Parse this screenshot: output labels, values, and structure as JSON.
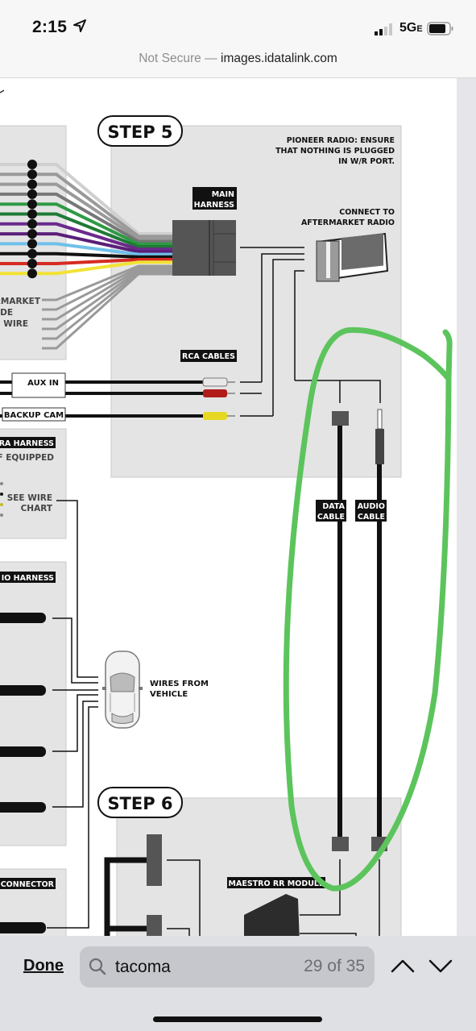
{
  "status_bar": {
    "time": "2:15",
    "location_icon": "location-arrow-icon",
    "signal_icon": "cellular-signal-icon",
    "network": "5G",
    "network_suffix": "E",
    "battery_icon": "battery-icon"
  },
  "url_bar": {
    "security_label": "Not Secure —",
    "host": "images.idatalink.com"
  },
  "diagram": {
    "step5": {
      "badge": "STEP 5",
      "note_lines": [
        "PIONEER RADIO: ENSURE",
        "THAT NOTHING IS PLUGGED",
        "IN W/R PORT."
      ],
      "main_harness_lines": [
        "MAIN",
        "HARNESS"
      ],
      "connect_lines": [
        "CONNECT TO",
        "AFTERMARKET RADIO"
      ],
      "rca_label": "RCA CABLES",
      "aux_in": "AUX IN",
      "backup_cam": "BACKUP CAM",
      "data_cable_lines": [
        "DATA",
        "CABLE"
      ],
      "audio_cable_lines": [
        "AUDIO",
        "CABLE"
      ]
    },
    "left_panel": {
      "aftermarket_lines": [
        "RMARKET",
        "IDE",
        "O WIRE"
      ],
      "camera_harness": "RA HARNESS",
      "if_equipped": "IF EQUIPPED",
      "see_wire_lines": [
        "SEE WIRE",
        "CHART"
      ],
      "radio_harness": "IO HARNESS",
      "connector": "CONNECTOR"
    },
    "vehicle": {
      "label_lines": [
        "WIRES FROM",
        "VEHICLE"
      ]
    },
    "step6": {
      "badge": "STEP 6",
      "module_label": "MAESTRO RR MODULE"
    },
    "harness_wire_colors": [
      "#ffffff",
      "#9a9a9a",
      "#9a9a9a",
      "#777777",
      "#2e9a45",
      "#1f7a35",
      "#6b2a8c",
      "#5a1f78",
      "#6fc0ea",
      "#111111",
      "#d62b22",
      "#f2e234"
    ],
    "annotation_color": "#5cc45c"
  },
  "find_bar": {
    "done_label": "Done",
    "query": "tacoma",
    "match_count": "29 of 35",
    "prev_icon": "chevron-up-icon",
    "next_icon": "chevron-down-icon"
  }
}
